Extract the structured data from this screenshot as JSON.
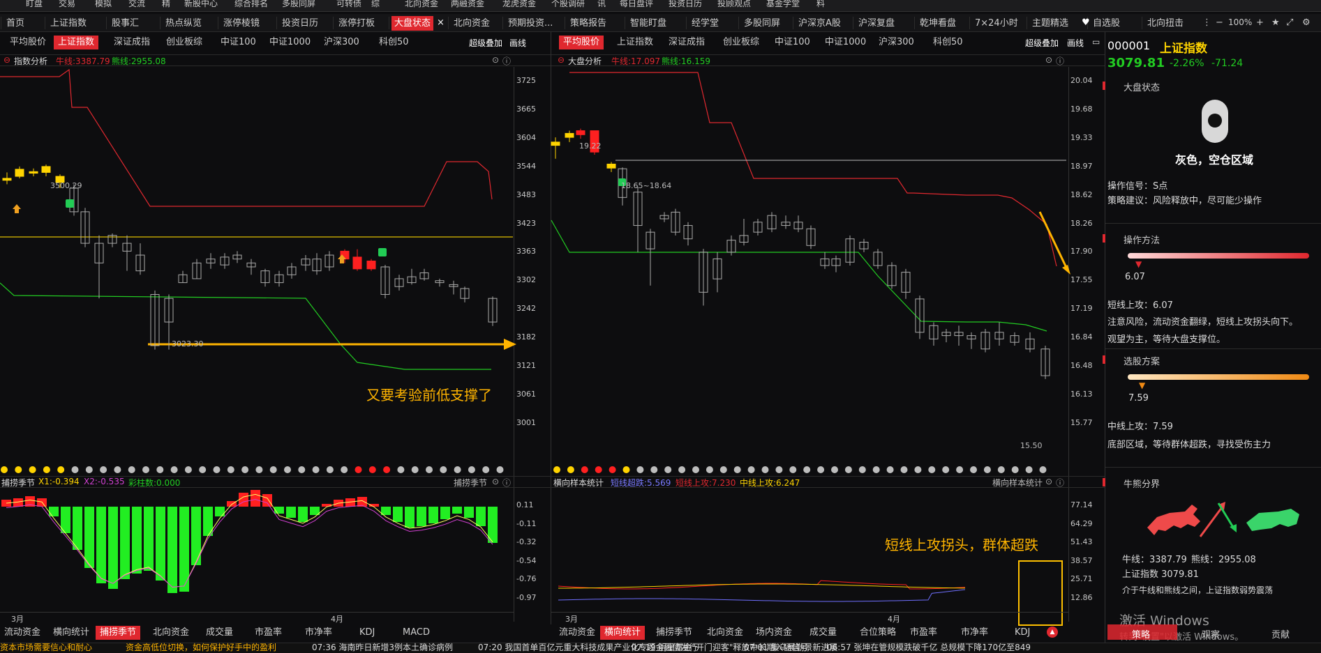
{
  "topnav": [
    "盯盘",
    "交易",
    "模拟",
    "交流",
    "精",
    "新股中心",
    "综合排名",
    "多股同屏",
    "可转债",
    "综",
    "北向资金",
    "两融资金",
    "龙虎资金",
    "个股调研",
    "讯",
    "每日盘评",
    "投资日历",
    "投顾观点",
    "基金学堂",
    "料"
  ],
  "tabs": [
    "首页",
    "上证指数",
    "股事汇",
    "热点纵览",
    "涨停棱镜",
    "投资日历",
    "涨停打板",
    "大盘状态",
    "北向资金",
    "预期投资...",
    "策略报告",
    "智能盯盘",
    "经学堂",
    "多股同屏",
    "沪深京A股",
    "沪深复盘",
    "乾坤看盘",
    "7×24小时",
    "主题精选",
    "自选股",
    "北向扭击"
  ],
  "tab_close": "×",
  "zoom": "100%",
  "left": {
    "subtabs": [
      "平均股价",
      "上证指数",
      "深证成指",
      "创业板综",
      "中证100",
      "中证1000",
      "沪深300",
      "科创50"
    ],
    "active_subtab": 1,
    "overlay": "超级叠加",
    "draw": "画线",
    "panel_title": "指数分析",
    "bull": "牛线:3387.79",
    "bear": "熊线:2955.08",
    "yticks": [
      "3725",
      "3665",
      "3604",
      "3544",
      "3483",
      "3423",
      "3363",
      "3302",
      "3242",
      "3182",
      "3121",
      "3061",
      "3001"
    ],
    "label_high": "3500.29",
    "label_low": "3023.30",
    "annotation": "又要考验前低支撑了",
    "ind_title": "捕捞季节",
    "ind_x1": "X1:-0.394",
    "ind_x2": "X2:-0.535",
    "ind_col": "彩柱数:0.000",
    "ind_name": "捕捞季节",
    "ind_ticks": [
      "0.11",
      "-0.11",
      "-0.32",
      "-0.54",
      "-0.76",
      "-0.97"
    ],
    "months": [
      "3月",
      "4月"
    ],
    "bottom_tabs": [
      "流动资金",
      "横向统计",
      "捕捞季节",
      "北向资金",
      "成交量",
      "市盈率",
      "市净率",
      "KDJ",
      "MACD"
    ],
    "active_bottom": 2
  },
  "mid": {
    "subtabs": [
      "平均股价",
      "上证指数",
      "深证成指",
      "创业板综",
      "中证100",
      "中证1000",
      "沪深300",
      "科创50"
    ],
    "active_subtab": 0,
    "overlay": "超级叠加",
    "draw": "画线",
    "panel_title": "大盘分析",
    "bull": "牛线:17.097",
    "bear": "熊线:16.159",
    "yticks": [
      "20.04",
      "19.68",
      "19.33",
      "18.97",
      "18.62",
      "18.26",
      "17.90",
      "17.55",
      "17.19",
      "16.84",
      "16.48",
      "16.13",
      "15.77"
    ],
    "label_high": "19.22",
    "label_mid": "18.65~18.64",
    "label_low": "15.50",
    "ind_title": "横向样本统计",
    "ind_a": "短线超跌:5.569",
    "ind_b": "短线上攻:7.230",
    "ind_c": "中线上攻:6.247",
    "ind_name": "横向样本统计",
    "ind_ticks": [
      "77.14",
      "64.29",
      "51.43",
      "38.57",
      "25.71",
      "12.86"
    ],
    "annotation": "短线上攻拐头，群体超跌",
    "months": [
      "3月",
      "4月"
    ],
    "bottom_tabs": [
      "流动资金",
      "横向统计",
      "捕捞季节",
      "北向资金",
      "场内资金",
      "成交量",
      "合位策略",
      "市盈率",
      "市净率",
      "KDJ"
    ],
    "active_bottom": 1
  },
  "right": {
    "code": "000001",
    "name": "上证指数",
    "price": "3079.81",
    "pct": "-2.26%",
    "chg": "-71.24",
    "s1_title": "大盘状态",
    "status": "灰色，空仓区域",
    "signal": "操作信号：S点",
    "advice": "策略建议：风险释放中，尽可能少操作",
    "s2_title": "操作方法",
    "m_val": "6.07",
    "m_line1": "短线上攻：6.07",
    "m_line2": "注意风险，流动资金翻绿，短线上攻拐头向下。",
    "m_line3": "观望为主，等待大盘支撑位。",
    "s3_title": "选股方案",
    "x_val": "7.59",
    "x_line1": "中线上攻：7.59",
    "x_line2": "底部区域，等待群体超跌，寻找受伤主力",
    "s4_title": "牛熊分界",
    "bull": "牛线：3387.79",
    "bear": "熊线：2955.08",
    "idx": "上证指数  3079.81",
    "desc": "介于牛线和熊线之间，上证指数弱势震荡",
    "watermark1": "激活 Windows",
    "watermark2": "转到\"设置\"以激活 Windows。",
    "btabs": [
      "策略",
      "观察",
      "贡献"
    ]
  },
  "ticker": [
    "资本市场需要信心和耐心",
    "资金高低位切换，如何保护好手中的盈利",
    "07:36 海南昨日新增3例本土确诊病例",
    "07:20 我国首单百亿元重大科技成果产业化专题金融債发行",
    "07:19 明星基金\"开门迎客\"释放中长期入场信号",
    "07:01 集乌晨勤景新进展",
    "06:57 张坤在管规模跌破千亿 总规模下降170亿至849"
  ],
  "colors": {
    "red": "#e0282f",
    "green": "#22cc22",
    "yellow": "#ffd400",
    "bg": "#0d0d0f"
  }
}
